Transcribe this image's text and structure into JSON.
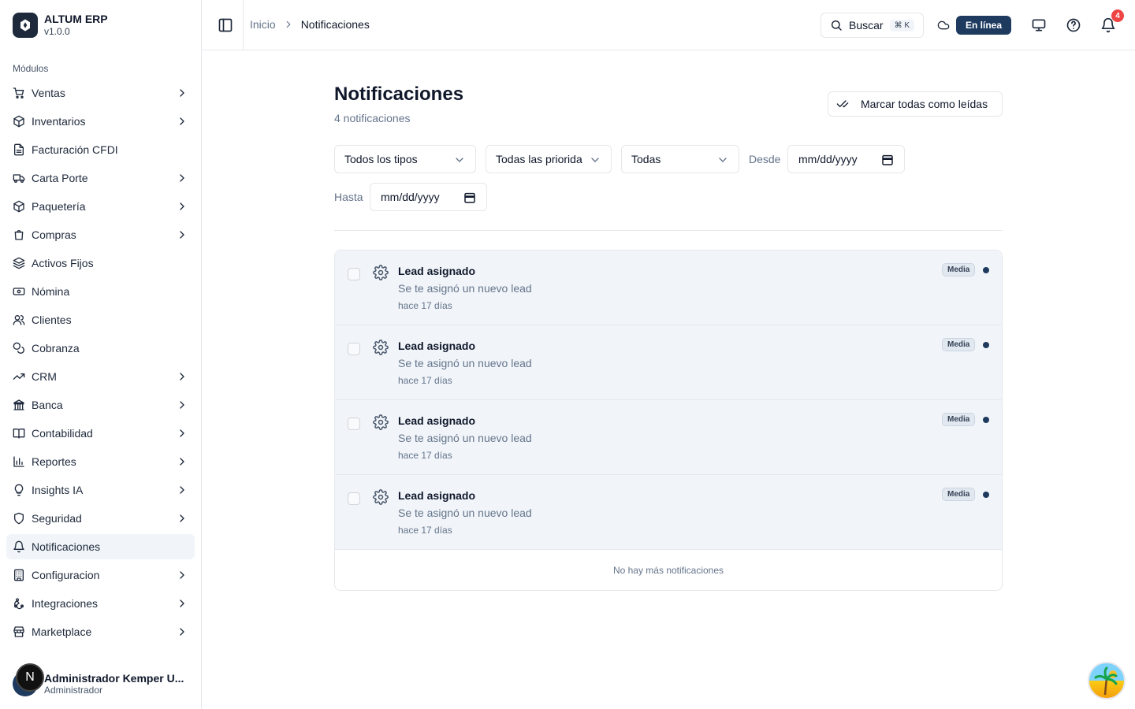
{
  "brand": {
    "name": "ALTUM ERP",
    "version": "v1.0.0"
  },
  "sidebar": {
    "section_label": "Módulos",
    "items": [
      {
        "label": "Ventas",
        "icon": "cart-icon",
        "expandable": true
      },
      {
        "label": "Inventarios",
        "icon": "package-icon",
        "expandable": true
      },
      {
        "label": "Facturación CFDI",
        "icon": "file-text-icon",
        "expandable": false
      },
      {
        "label": "Carta Porte",
        "icon": "truck-icon",
        "expandable": true
      },
      {
        "label": "Paquetería",
        "icon": "package-icon",
        "expandable": true
      },
      {
        "label": "Compras",
        "icon": "shopping-bag-icon",
        "expandable": true
      },
      {
        "label": "Activos Fijos",
        "icon": "layers-icon",
        "expandable": false
      },
      {
        "label": "Nómina",
        "icon": "banknote-icon",
        "expandable": false
      },
      {
        "label": "Clientes",
        "icon": "users-icon",
        "expandable": false
      },
      {
        "label": "Cobranza",
        "icon": "coins-icon",
        "expandable": false
      },
      {
        "label": "CRM",
        "icon": "trending-up-icon",
        "expandable": true
      },
      {
        "label": "Banca",
        "icon": "bank-icon",
        "expandable": true
      },
      {
        "label": "Contabilidad",
        "icon": "book-icon",
        "expandable": true
      },
      {
        "label": "Reportes",
        "icon": "bar-chart-icon",
        "expandable": true
      },
      {
        "label": "Insights IA",
        "icon": "lightbulb-icon",
        "expandable": true
      },
      {
        "label": "Seguridad",
        "icon": "shield-icon",
        "expandable": true
      },
      {
        "label": "Notificaciones",
        "icon": "bell-icon",
        "expandable": false,
        "active": true
      },
      {
        "label": "Configuracion",
        "icon": "building-icon",
        "expandable": true
      },
      {
        "label": "Integraciones",
        "icon": "webhook-icon",
        "expandable": true
      },
      {
        "label": "Marketplace",
        "icon": "store-icon",
        "expandable": true
      }
    ],
    "user": {
      "name": "Administrador Kemper U...",
      "role": "Administrador",
      "initial": "N"
    }
  },
  "header": {
    "breadcrumb_home": "Inicio",
    "breadcrumb_current": "Notificaciones",
    "search_label": "Buscar",
    "search_shortcut": "⌘ K",
    "status_label": "En línea",
    "notification_count": "4"
  },
  "main": {
    "title": "Notificaciones",
    "subtitle": "4 notificaciones",
    "mark_all_label": "Marcar todas como leídas",
    "filters": {
      "type": "Todos los tipos",
      "priority": "Todas las priorida",
      "status": "Todas",
      "from_label": "Desde",
      "from_value": "mm/dd/yyyy",
      "to_label": "Hasta",
      "to_value": "mm/dd/yyyy"
    },
    "notifications": [
      {
        "title": "Lead asignado",
        "message": "Se te asignó un nuevo lead",
        "time": "hace 17 días",
        "priority": "Media",
        "unread": true
      },
      {
        "title": "Lead asignado",
        "message": "Se te asignó un nuevo lead",
        "time": "hace 17 días",
        "priority": "Media",
        "unread": true
      },
      {
        "title": "Lead asignado",
        "message": "Se te asignó un nuevo lead",
        "time": "hace 17 días",
        "priority": "Media",
        "unread": true
      },
      {
        "title": "Lead asignado",
        "message": "Se te asignó un nuevo lead",
        "time": "hace 17 días",
        "priority": "Media",
        "unread": true
      }
    ],
    "end_message": "No hay más notificaciones"
  },
  "colors": {
    "accent": "#1e3a5f",
    "badge": "#ef4444",
    "row_bg": "#f1f5f9"
  }
}
